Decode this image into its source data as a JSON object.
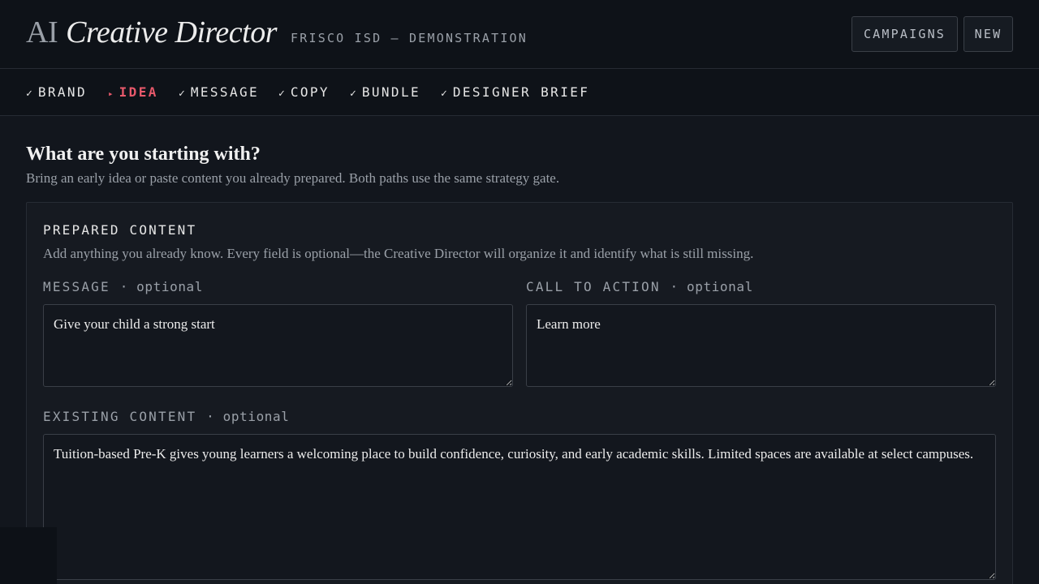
{
  "header": {
    "brand_prefix": "AI",
    "brand_title": "Creative Director",
    "subtitle": "FRISCO ISD — DEMONSTRATION",
    "buttons": {
      "campaigns": "CAMPAIGNS",
      "new": "NEW"
    }
  },
  "steps": [
    {
      "mark": "✓",
      "label": "BRAND",
      "state": "done"
    },
    {
      "mark": "▸",
      "label": "IDEA",
      "state": "active"
    },
    {
      "mark": "✓",
      "label": "MESSAGE",
      "state": "done"
    },
    {
      "mark": "✓",
      "label": "COPY",
      "state": "done"
    },
    {
      "mark": "✓",
      "label": "BUNDLE",
      "state": "done"
    },
    {
      "mark": "✓",
      "label": "DESIGNER BRIEF",
      "state": "done"
    }
  ],
  "colors": {
    "active_step": "#e8596b",
    "background": "#0d1117"
  },
  "main": {
    "question": "What are you starting with?",
    "description": "Bring an early idea or paste content you already prepared. Both paths use the same strategy gate.",
    "card": {
      "title": "PREPARED CONTENT",
      "description": "Add anything you already know. Every field is optional—the Creative Director will organize it and identify what is still missing.",
      "fields": {
        "message": {
          "label": "MESSAGE",
          "optional": "· optional",
          "value": "Give your child a strong start"
        },
        "cta": {
          "label": "CALL TO ACTION",
          "optional": "· optional",
          "value": "Learn more"
        },
        "existing": {
          "label": "EXISTING CONTENT",
          "optional": "· optional",
          "value": "Tuition-based Pre-K gives young learners a welcoming place to build confidence, curiosity, and early academic skills. Limited spaces are available at select campuses."
        }
      }
    }
  }
}
